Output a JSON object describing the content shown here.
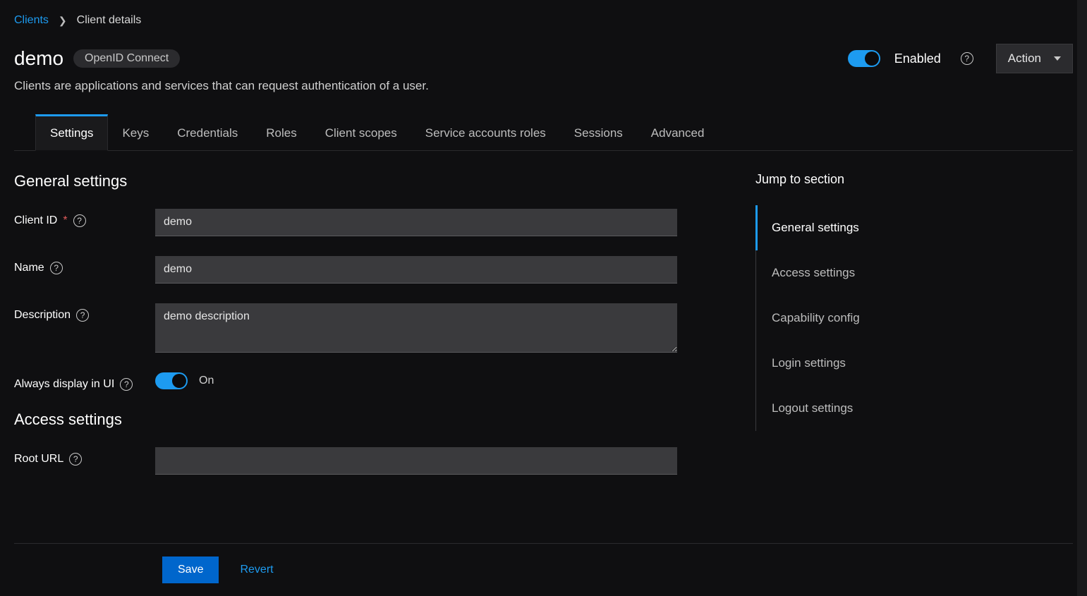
{
  "breadcrumb": {
    "root": "Clients",
    "current": "Client details"
  },
  "header": {
    "title": "demo",
    "badge": "OpenID Connect",
    "enabled_label": "Enabled",
    "action_label": "Action"
  },
  "subtitle": "Clients are applications and services that can request authentication of a user.",
  "tabs": [
    "Settings",
    "Keys",
    "Credentials",
    "Roles",
    "Client scopes",
    "Service accounts roles",
    "Sessions",
    "Advanced"
  ],
  "active_tab_index": 0,
  "sections": {
    "general_title": "General settings",
    "access_title": "Access settings"
  },
  "fields": {
    "client_id": {
      "label": "Client ID",
      "value": "demo",
      "required": true
    },
    "name": {
      "label": "Name",
      "value": "demo"
    },
    "description": {
      "label": "Description",
      "value": "demo description"
    },
    "always_display": {
      "label": "Always display in UI",
      "value_label": "On"
    },
    "root_url": {
      "label": "Root URL",
      "value": ""
    }
  },
  "jump": {
    "title": "Jump to section",
    "items": [
      "General settings",
      "Access settings",
      "Capability config",
      "Login settings",
      "Logout settings"
    ],
    "active_index": 0
  },
  "footer": {
    "save": "Save",
    "revert": "Revert"
  }
}
